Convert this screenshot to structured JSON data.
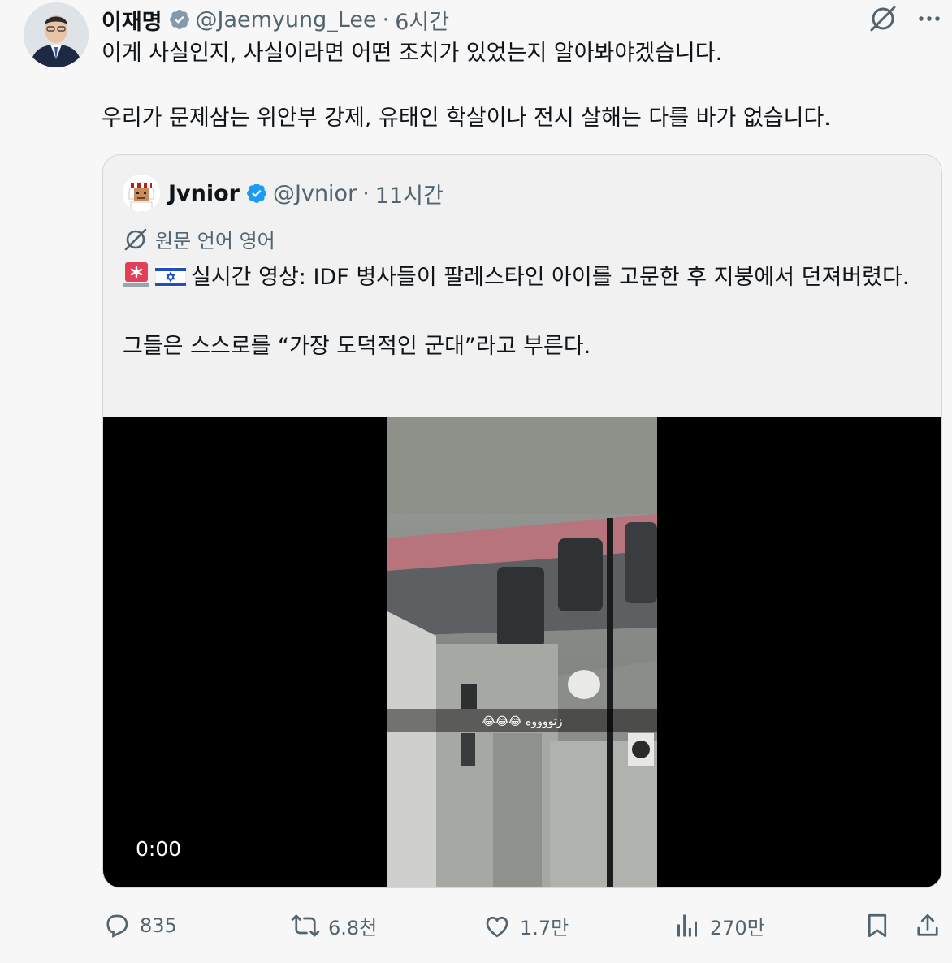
{
  "author": {
    "name": "이재명",
    "handle": "@Jaemyung_Lee",
    "separator": "·",
    "time": "6시간"
  },
  "tweet": {
    "paragraphs": [
      "이게 사실인지, 사실이라면 어떤 조치가 있었는지 알아봐야겠습니다.",
      "우리가 문제삼는 위안부 강제, 유태인 학살이나 전시 살해는 다를 바가 없습니다."
    ]
  },
  "quote": {
    "name": "Jvnior",
    "handle": "@Jvnior",
    "separator": "·",
    "time": "11시간",
    "translate_label": "원문 언어 영어",
    "line1": "실시간 영상: IDF 병사들이 팔레스타인 아이를 고문한 후 지붕에서 던져버렸다.",
    "line2": "그들은 스스로를 “가장 도덕적인 군대”라고 부른다.",
    "video": {
      "timestamp": "0:00",
      "caption": "😂😂😂 زتووووه"
    }
  },
  "actions": {
    "replies": "835",
    "reposts": "6.8천",
    "likes": "1.7만",
    "views": "270만"
  },
  "colors": {
    "background": "#f7f7f7",
    "text": "#0f1419",
    "muted": "#536471",
    "verified_grey": "#829aab",
    "verified_blue": "#1d9bf0",
    "border": "#cfd9de"
  },
  "icons": [
    "grok-icon",
    "more-icon",
    "reply-icon",
    "repost-icon",
    "like-icon",
    "views-icon",
    "bookmark-icon",
    "share-icon",
    "translate-icon",
    "siren-emoji",
    "israel-flag-emoji"
  ]
}
